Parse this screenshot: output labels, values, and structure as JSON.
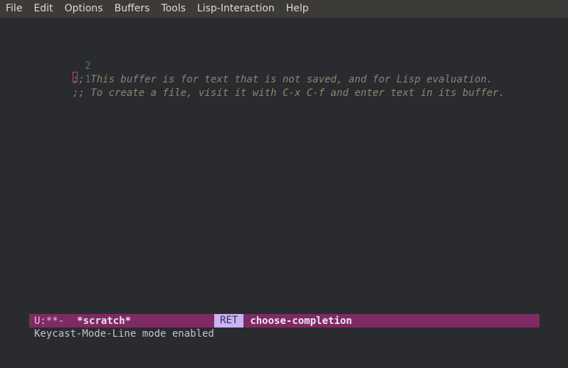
{
  "menubar": {
    "items": [
      "File",
      "Edit",
      "Options",
      "Buffers",
      "Tools",
      "Lisp-Interaction",
      "Help"
    ]
  },
  "buffer": {
    "lines": [
      {
        "number": "2",
        "text": ";; This buffer is for text that is not saved, and for Lisp evaluation."
      },
      {
        "number": "1",
        "text": ";; To create a file, visit it with C-x C-f and enter text in its buffer."
      }
    ]
  },
  "modeline": {
    "status": "U:**-",
    "buffer_name": "*scratch*",
    "key": "RET",
    "command": "choose-completion"
  },
  "echo": {
    "message": "Keycast-Mode-Line mode enabled"
  },
  "colors": {
    "background": "#292b2e",
    "menubar": "#3c3b37",
    "modeline": "#7e2b62",
    "keycast": "#c9b3f4",
    "comment": "#8f8370",
    "cursor": "#c8437a"
  }
}
